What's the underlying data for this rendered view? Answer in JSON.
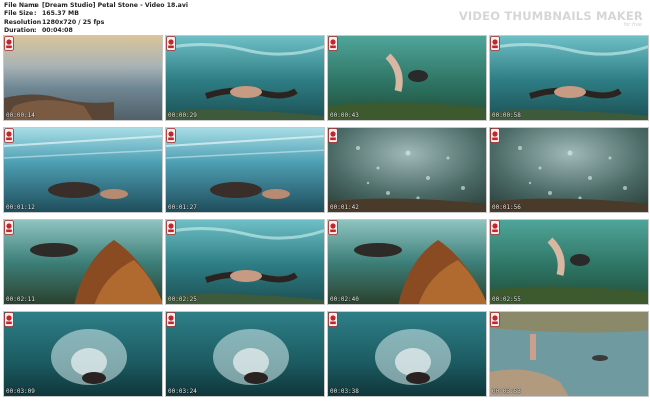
{
  "info": [
    {
      "key": "File Name",
      "value": "[Dream Studio] Petal Stone - Video 18.avi"
    },
    {
      "key": "File Size",
      "value": "165.37 MB"
    },
    {
      "key": "Resolution",
      "value": "1280x720 / 25 fps"
    },
    {
      "key": "Duration",
      "value": "00:04:08"
    }
  ],
  "brand": "VIDEO THUMBNAILS MAKER",
  "brand_sub": "for free",
  "thumbnails": [
    {
      "time": "00:00:14",
      "scene": "shore-sunset"
    },
    {
      "time": "00:00:29",
      "scene": "underwater-swimmer"
    },
    {
      "time": "00:00:43",
      "scene": "underwater-green"
    },
    {
      "time": "00:00:58",
      "scene": "underwater-swimmer"
    },
    {
      "time": "00:01:12",
      "scene": "underwater-surface"
    },
    {
      "time": "00:01:27",
      "scene": "underwater-surface"
    },
    {
      "time": "00:01:42",
      "scene": "bubbles"
    },
    {
      "time": "00:01:56",
      "scene": "bubbles"
    },
    {
      "time": "00:02:11",
      "scene": "seaweed"
    },
    {
      "time": "00:02:25",
      "scene": "underwater-swimmer"
    },
    {
      "time": "00:02:40",
      "scene": "seaweed"
    },
    {
      "time": "00:02:55",
      "scene": "underwater-green"
    },
    {
      "time": "00:03:09",
      "scene": "splash"
    },
    {
      "time": "00:03:24",
      "scene": "splash"
    },
    {
      "time": "00:03:38",
      "scene": "splash"
    },
    {
      "time": "00:03:53",
      "scene": "rock-pool"
    }
  ]
}
